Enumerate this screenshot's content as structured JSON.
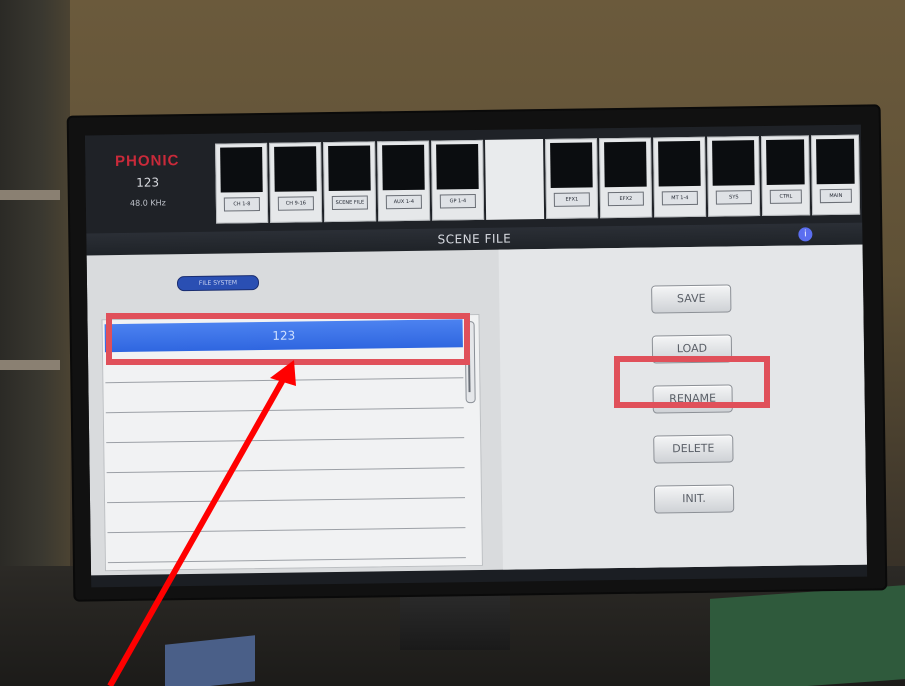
{
  "header": {
    "brand": "PHONIC",
    "scene_number": "123",
    "sample_rate": "48.0 KHz"
  },
  "left_tiles": [
    "CH 1-8",
    "CH 9-16",
    "SCENE FILE",
    "AUX 1-4",
    "GP 1-4"
  ],
  "right_tiles": [
    "EFX1",
    "EFX2",
    "MT 1-4",
    "SYS",
    "CTRL",
    "MAIN"
  ],
  "title": "SCENE FILE",
  "info_icon": "info-icon",
  "file_system_label": "FILE SYSTEM",
  "files": [
    "123",
    "",
    "",
    "",
    "",
    "",
    "",
    ""
  ],
  "selected_index": 0,
  "buttons": {
    "save": "SAVE",
    "load": "LOAD",
    "rename": "RENAME",
    "delete": "DELETE",
    "init": "INIT."
  },
  "annotation_color": "#e0505a",
  "arrow_color": "#ff0000"
}
